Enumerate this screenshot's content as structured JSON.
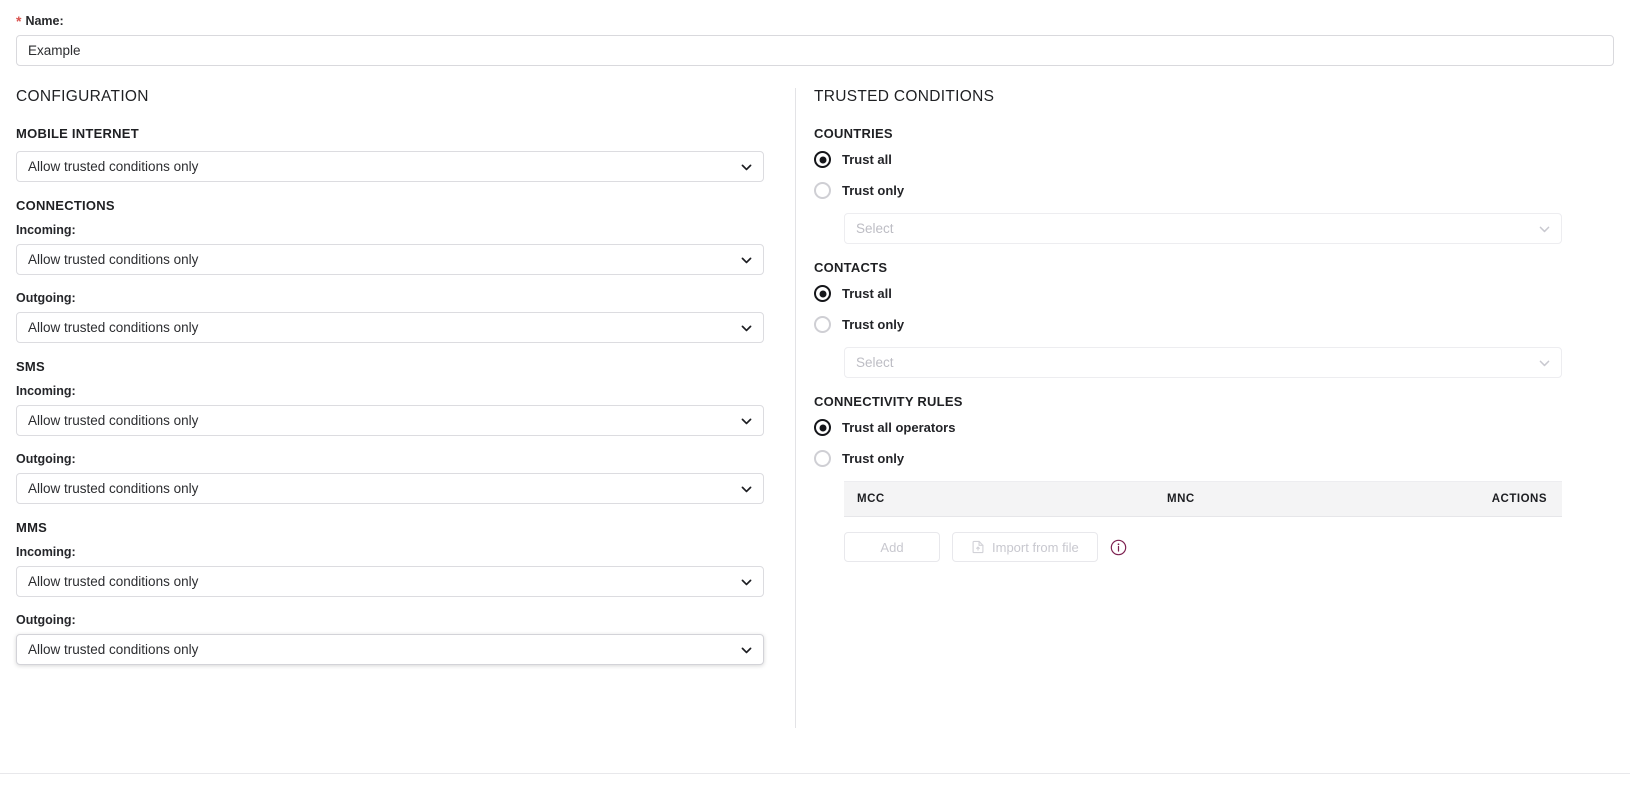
{
  "form": {
    "name_label": "Name:",
    "required_marker": "*",
    "name_value": "Example"
  },
  "configuration": {
    "title": "CONFIGURATION",
    "groups": [
      {
        "title": "MOBILE INTERNET",
        "fields": [
          {
            "label": "",
            "value": "Allow trusted conditions only"
          }
        ]
      },
      {
        "title": "CONNECTIONS",
        "fields": [
          {
            "label": "Incoming:",
            "value": "Allow trusted conditions only"
          },
          {
            "label": "Outgoing:",
            "value": "Allow trusted conditions only"
          }
        ]
      },
      {
        "title": "SMS",
        "fields": [
          {
            "label": "Incoming:",
            "value": "Allow trusted conditions only"
          },
          {
            "label": "Outgoing:",
            "value": "Allow trusted conditions only"
          }
        ]
      },
      {
        "title": "MMS",
        "fields": [
          {
            "label": "Incoming:",
            "value": "Allow trusted conditions only"
          },
          {
            "label": "Outgoing:",
            "value": "Allow trusted conditions only"
          }
        ]
      }
    ]
  },
  "trusted_conditions": {
    "title": "TRUSTED CONDITIONS",
    "countries": {
      "title": "COUNTRIES",
      "option_all": "Trust all",
      "option_only": "Trust only",
      "selected": "Trust all",
      "select_placeholder": "Select"
    },
    "contacts": {
      "title": "CONTACTS",
      "option_all": "Trust all",
      "option_only": "Trust only",
      "selected": "Trust all",
      "select_placeholder": "Select"
    },
    "connectivity_rules": {
      "title": "CONNECTIVITY RULES",
      "option_all": "Trust all operators",
      "option_only": "Trust only",
      "selected": "Trust all operators",
      "table": {
        "columns": [
          "MCC",
          "MNC",
          "ACTIONS"
        ],
        "rows": []
      },
      "add_label": "Add",
      "import_label": "Import from file",
      "info_icon": "info-circle-icon"
    }
  },
  "colors": {
    "required": "#d9534f",
    "info": "#7d2150",
    "text": "#222222",
    "border": "#dcdce0",
    "table_header_bg": "#f4f4f5"
  }
}
